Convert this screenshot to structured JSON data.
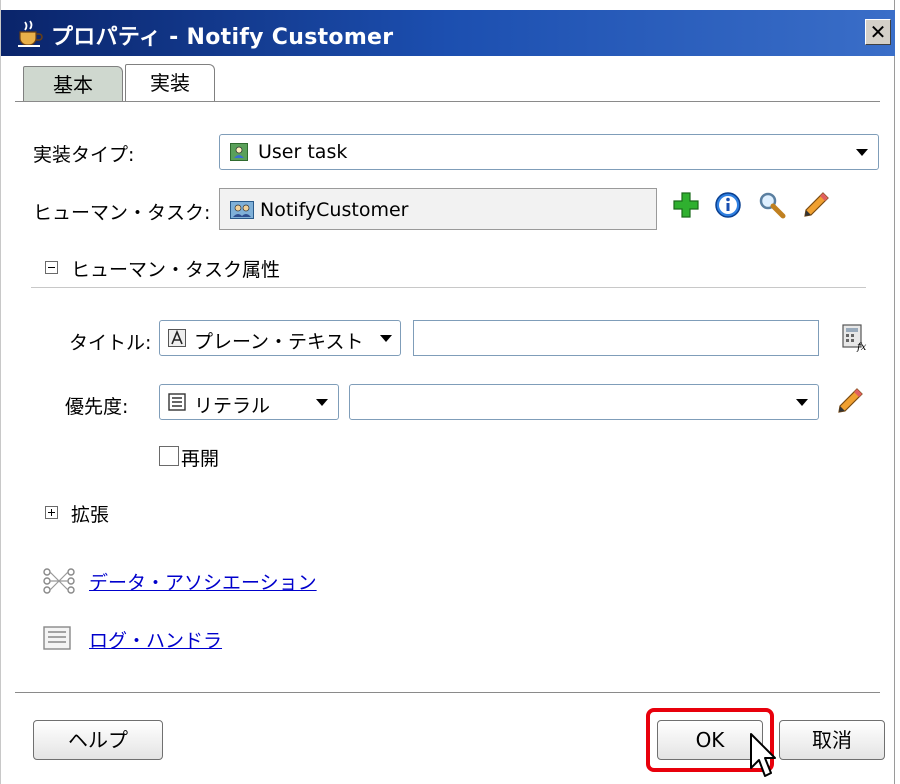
{
  "window": {
    "title": "プロパティ - Notify Customer",
    "close_glyph": "✕",
    "icon": "coffee-cup-icon"
  },
  "tabs": [
    {
      "label": "基本",
      "active": false
    },
    {
      "label": "実装",
      "active": true
    }
  ],
  "implementation": {
    "type_label": "実装タイプ:",
    "type_value": "User task",
    "type_icon": "user-task-icon",
    "human_task_label": "ヒューマン・タスク:",
    "human_task_value": "NotifyCustomer",
    "human_task_icon": "human-task-icon",
    "actions": [
      "add-icon",
      "info-icon",
      "search-icon",
      "edit-icon"
    ]
  },
  "human_task_attributes": {
    "section_label": "ヒューマン・タスク属性",
    "expanded": true,
    "title_label": "タイトル:",
    "title_mode": "プレーン・テキスト",
    "title_value": "",
    "priority_label": "優先度:",
    "priority_mode": "リテラル",
    "priority_value": "",
    "reopen_label": "再開",
    "reopen_checked": false
  },
  "extension": {
    "section_label": "拡張",
    "expanded": false
  },
  "links": {
    "data_association": "データ・アソシエーション",
    "log_handler": "ログ・ハンドラ"
  },
  "buttons": {
    "help": "ヘルプ",
    "ok": "OK",
    "cancel": "取消"
  },
  "colors": {
    "titlebar": "#0a246a",
    "highlight": "#e8000c",
    "link": "#0000cc"
  }
}
